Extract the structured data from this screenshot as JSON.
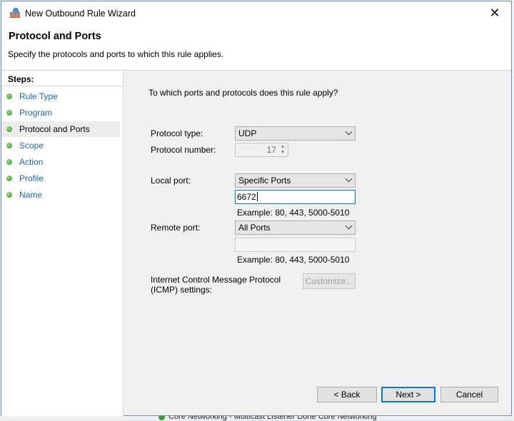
{
  "window": {
    "title": "New Outbound Rule Wizard",
    "close_glyph": "✕"
  },
  "header": {
    "title": "Protocol and Ports",
    "subtitle": "Specify the protocols and ports to which this rule applies."
  },
  "steps": {
    "label": "Steps:",
    "items": [
      {
        "label": "Rule Type"
      },
      {
        "label": "Program"
      },
      {
        "label": "Protocol and Ports"
      },
      {
        "label": "Scope"
      },
      {
        "label": "Action"
      },
      {
        "label": "Profile"
      },
      {
        "label": "Name"
      }
    ],
    "active_index": 2
  },
  "form": {
    "question": "To which ports and protocols does this rule apply?",
    "protocol_type_label": "Protocol type:",
    "protocol_type_value": "UDP",
    "protocol_number_label": "Protocol number:",
    "protocol_number_value": "17",
    "local_port_label": "Local port:",
    "local_port_mode": "Specific Ports",
    "local_port_value": "6672",
    "local_port_example": "Example: 80, 443, 5000-5010",
    "remote_port_label": "Remote port:",
    "remote_port_mode": "All Ports",
    "remote_port_value": "",
    "remote_port_example": "Example: 80, 443, 5000-5010",
    "icmp_label_line1": "Internet Control Message Protocol",
    "icmp_label_line2": "(ICMP) settings:",
    "customize_label": "Customize..."
  },
  "footer": {
    "back_label": "< Back",
    "next_label": "Next >",
    "cancel_label": "Cancel"
  },
  "background": {
    "bottom_text": "Core Networking - Multicast Listener Done  Core Networking"
  },
  "colors": {
    "link_blue": "#1b66b5",
    "focus_blue": "#0078d7",
    "step_dot_green": "#2e9a21"
  }
}
